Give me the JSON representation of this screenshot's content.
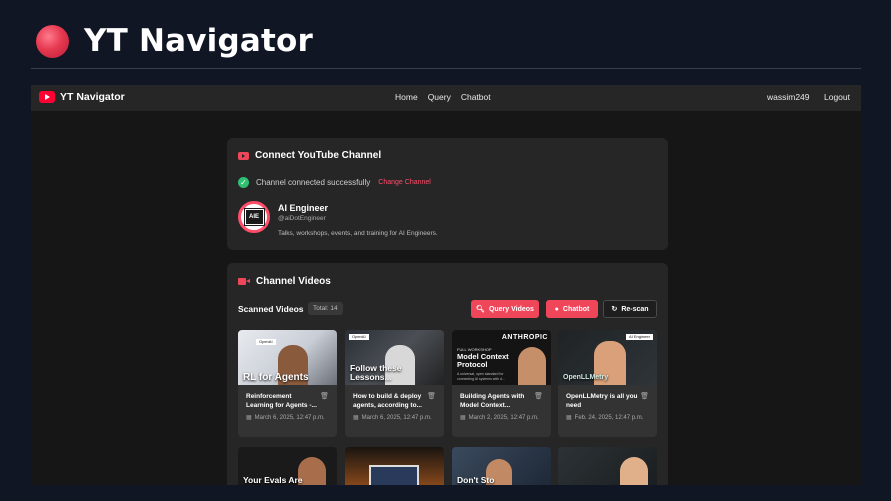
{
  "hero": {
    "title": "YT Navigator"
  },
  "navbar": {
    "brand": "YT Navigator",
    "links": [
      "Home",
      "Query",
      "Chatbot"
    ],
    "username": "wassim249",
    "logout": "Logout"
  },
  "connect": {
    "heading": "Connect YouTube Channel",
    "status": "Channel connected successfully",
    "change_link": "Change Channel",
    "channel_name": "AI Engineer",
    "channel_handle": "@aiDotEngineer",
    "channel_desc": "Talks, workshops, events, and training for AI Engineers.",
    "avatar_text": "AIE"
  },
  "videos": {
    "heading": "Channel Videos",
    "scanned_label": "Scanned Videos",
    "total": "Total: 14",
    "buttons": {
      "query": "Query Videos",
      "chatbot": "Chatbot",
      "rescan": "Re-scan"
    },
    "items": [
      {
        "thumb_text": "RL for Agents",
        "thumb_tag": "OpenAI",
        "title": "Reinforcement Learning for Agents -...",
        "date": "March 6, 2025, 12:47 p.m."
      },
      {
        "thumb_text": "Follow these Lessons...",
        "thumb_tag": "OpenAI",
        "title": "How to build & deploy agents, according to...",
        "date": "March 6, 2025, 12:47 p.m."
      },
      {
        "thumb_text": "Model Context Protocol",
        "thumb_tag": "ANTHROPIC",
        "thumb_sub": "FULL WORKSHOP",
        "thumb_small": "A universal, open standard for connecting AI systems with d...",
        "title": "Building Agents with Model Context...",
        "date": "March 2, 2025, 12:47 p.m."
      },
      {
        "thumb_text": "OpenLLMetry",
        "thumb_tag": "AI Engineer",
        "title": "OpenLLMetry is all you need",
        "date": "Feb. 24, 2025, 12:47 p.m."
      }
    ],
    "row2": [
      {
        "thumb_text": "Your Evals Are"
      },
      {
        "thumb_text": ""
      },
      {
        "thumb_text": "Don't Sto"
      },
      {
        "thumb_text": ""
      }
    ]
  }
}
